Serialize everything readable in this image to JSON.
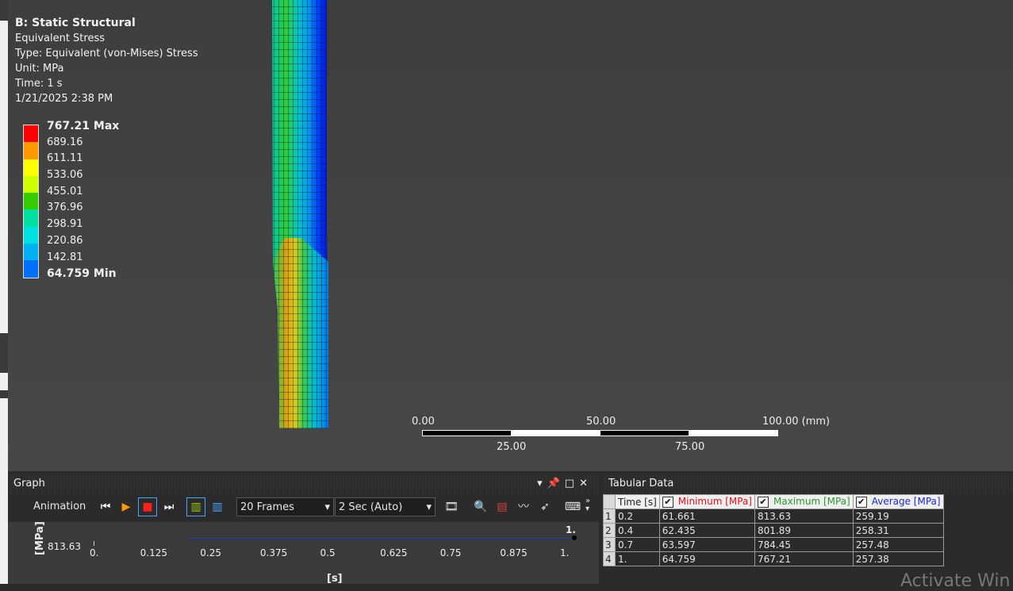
{
  "result": {
    "system": "B: Static Structural",
    "name": "Equivalent Stress",
    "type": "Type: Equivalent (von-Mises) Stress",
    "unit": "Unit: MPa",
    "time": "Time: 1 s",
    "date": "1/21/2025 2:38 PM"
  },
  "legend": {
    "labels": [
      "767.21 Max",
      "689.16",
      "611.11",
      "533.06",
      "455.01",
      "376.96",
      "298.91",
      "220.86",
      "142.81",
      "64.759 Min"
    ],
    "colors": [
      "#ff0000",
      "#ff9900",
      "#ffff00",
      "#ccff00",
      "#33cc00",
      "#00e0a0",
      "#00e0e0",
      "#00b0f0",
      "#0070ff",
      "#0000ff"
    ]
  },
  "scale": {
    "l0": "0.00",
    "l25": "25.00",
    "l50": "50.00",
    "l75": "75.00",
    "l100": "100.00 (mm)"
  },
  "graph": {
    "title": "Graph",
    "animation_label": "Animation",
    "frames": "20 Frames",
    "duration": "2 Sec (Auto)",
    "y_label": "[MPa]",
    "y_value": "813.63",
    "end_label": "1.",
    "x_ticks": [
      "0.",
      "0.125",
      "0.25",
      "0.375",
      "0.5",
      "0.625",
      "0.75",
      "0.875",
      "1."
    ],
    "x_label": "[s]"
  },
  "tabular": {
    "title": "Tabular Data",
    "headers": [
      "Time [s]",
      "Minimum [MPa]",
      "Maximum [MPa]",
      "Average [MPa]"
    ],
    "header_colors": [
      "#222222",
      "#e0101a",
      "#2a9a2a",
      "#1a2ad0"
    ],
    "rows": [
      [
        "1",
        "0.2",
        "61.661",
        "813.63",
        "259.19"
      ],
      [
        "2",
        "0.4",
        "62.435",
        "801.89",
        "258.31"
      ],
      [
        "3",
        "0.7",
        "63.597",
        "784.45",
        "257.48"
      ],
      [
        "4",
        "1.",
        "64.759",
        "767.21",
        "257.38"
      ]
    ]
  },
  "watermark": "Activate Win"
}
